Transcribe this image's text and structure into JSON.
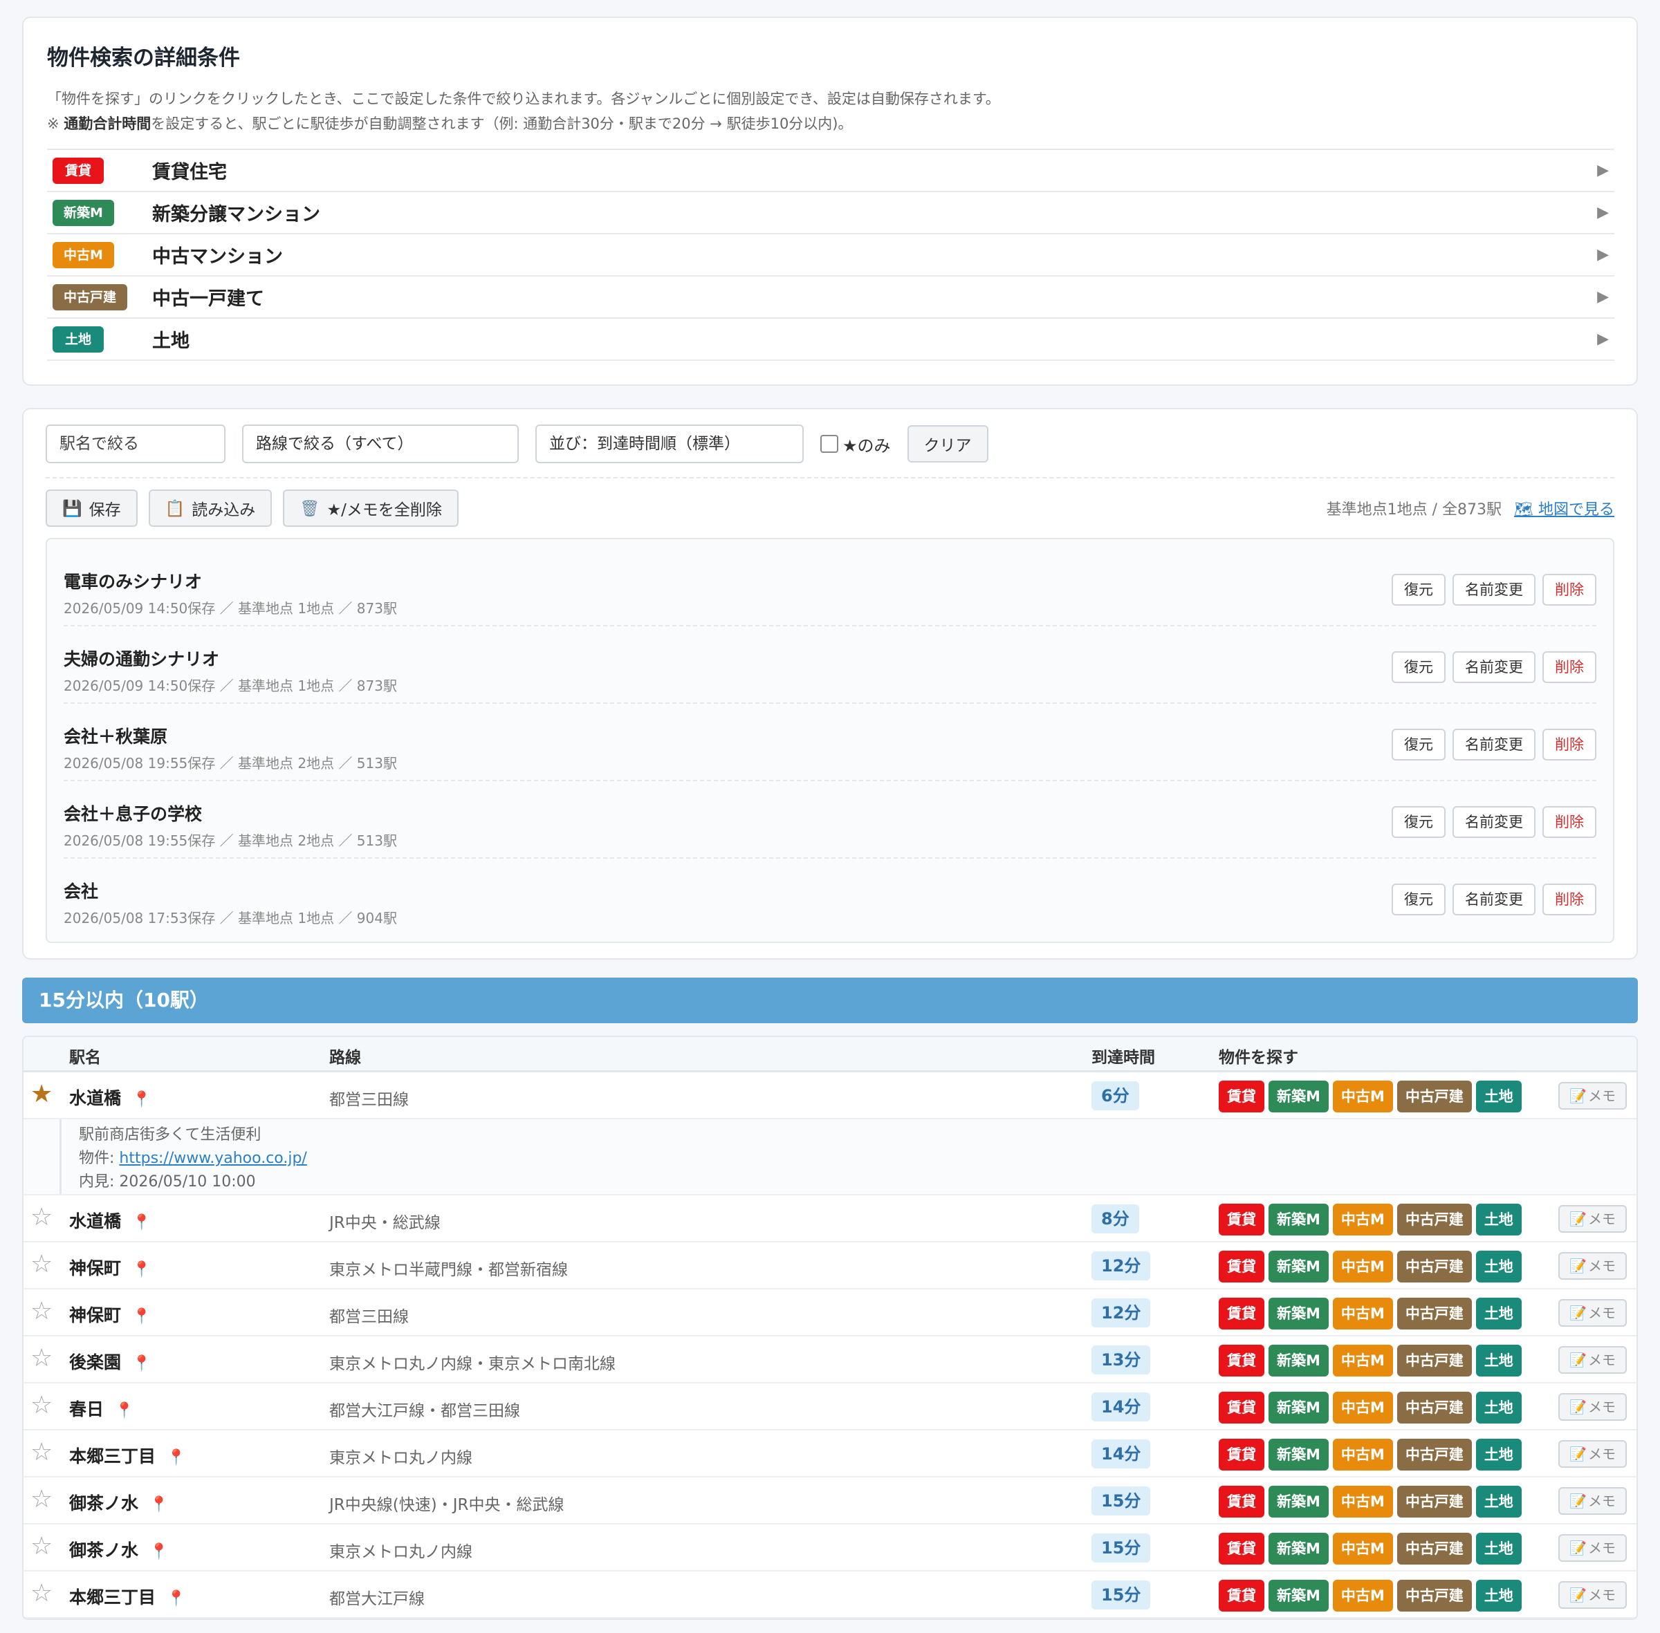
{
  "criteria": {
    "title": "物件検索の詳細条件",
    "desc1": "「物件を探す」のリンクをクリックしたとき、ここで設定した条件で絞り込まれます。各ジャンルごとに個別設定でき、設定は自動保存されます。",
    "desc2_prefix": "※ ",
    "desc2_bold": "通勤合計時間",
    "desc2_rest": "を設定すると、駅ごとに駅徒歩が自動調整されます（例: 通勤合計30分・駅まで20分 → 駅徒歩10分以内)。",
    "genres": [
      {
        "tag": "賃貸",
        "name": "賃貸住宅",
        "color": "#e8141a"
      },
      {
        "tag": "新築M",
        "name": "新築分譲マンション",
        "color": "#2e8a57"
      },
      {
        "tag": "中古M",
        "name": "中古マンション",
        "color": "#e88a0c"
      },
      {
        "tag": "中古戸建",
        "name": "中古一戸建て",
        "color": "#8a6d45"
      },
      {
        "tag": "土地",
        "name": "土地",
        "color": "#1a8a7a"
      }
    ],
    "arrow": "▶"
  },
  "filters": {
    "station_placeholder": "駅名で絞る",
    "line_select": "路線で絞る（すべて）",
    "sort_select": "並び：到達時間順（標準）",
    "star_only": "★のみ",
    "clear": "クリア"
  },
  "actions": {
    "save": "保存",
    "load": "読み込み",
    "delete_all": "★/メモを全削除",
    "summary": "基準地点1地点 / 全873駅",
    "map_link": "地図で見る"
  },
  "scenario_buttons": {
    "restore": "復元",
    "rename": "名前変更",
    "delete": "削除"
  },
  "scenarios": [
    {
      "name": "電車のみシナリオ",
      "meta": "2026/05/09 14:50保存 ／ 基準地点 1地点 ／ 873駅"
    },
    {
      "name": "夫婦の通勤シナリオ",
      "meta": "2026/05/09 14:50保存 ／ 基準地点 1地点 ／ 873駅"
    },
    {
      "name": "会社＋秋葉原",
      "meta": "2026/05/08 19:55保存 ／ 基準地点 2地点 ／ 513駅"
    },
    {
      "name": "会社＋息子の学校",
      "meta": "2026/05/08 19:55保存 ／ 基準地点 2地点 ／ 513駅"
    },
    {
      "name": "会社",
      "meta": "2026/05/08 17:53保存 ／ 基準地点 1地点 ／ 904駅"
    }
  ],
  "group": {
    "title": "15分以内（10駅）"
  },
  "table": {
    "headers": {
      "station": "駅名",
      "line": "路線",
      "time": "到達時間",
      "search": "物件を探す"
    },
    "genre_buttons": [
      "賃貸",
      "新築M",
      "中古M",
      "中古戸建",
      "土地"
    ],
    "memo_label": "メモ",
    "rows": [
      {
        "starred": true,
        "station": "水道橋",
        "line": "都営三田線",
        "time": "6分",
        "memo": {
          "note": "駅前商店街多くて生活便利",
          "link_label": "物件: ",
          "link": "https://www.yahoo.co.jp/",
          "visit": "内見: 2026/05/10 10:00"
        }
      },
      {
        "starred": false,
        "station": "水道橋",
        "line": "JR中央・総武線",
        "time": "8分"
      },
      {
        "starred": false,
        "station": "神保町",
        "line": "東京メトロ半蔵門線・都営新宿線",
        "time": "12分"
      },
      {
        "starred": false,
        "station": "神保町",
        "line": "都営三田線",
        "time": "12分"
      },
      {
        "starred": false,
        "station": "後楽園",
        "line": "東京メトロ丸ノ内線・東京メトロ南北線",
        "time": "13分"
      },
      {
        "starred": false,
        "station": "春日",
        "line": "都営大江戸線・都営三田線",
        "time": "14分"
      },
      {
        "starred": false,
        "station": "本郷三丁目",
        "line": "東京メトロ丸ノ内線",
        "time": "14分"
      },
      {
        "starred": false,
        "station": "御茶ノ水",
        "line": "JR中央線(快速)・JR中央・総武線",
        "time": "15分"
      },
      {
        "starred": false,
        "station": "御茶ノ水",
        "line": "東京メトロ丸ノ内線",
        "time": "15分"
      },
      {
        "starred": false,
        "station": "本郷三丁目",
        "line": "都営大江戸線",
        "time": "15分"
      }
    ]
  }
}
